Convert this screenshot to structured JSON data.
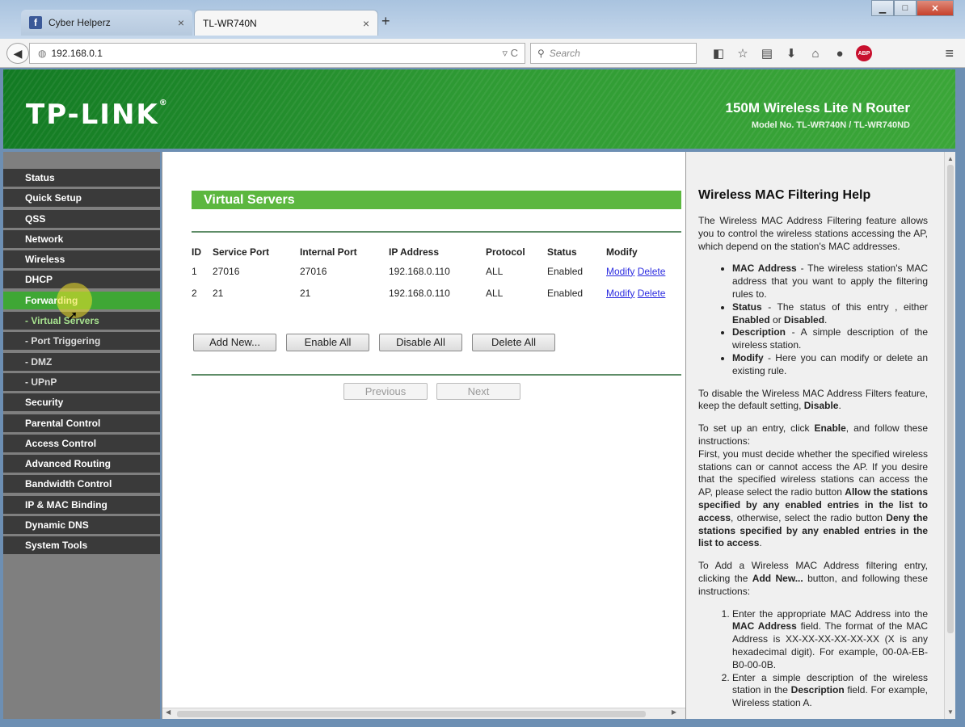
{
  "browser": {
    "tabs": [
      {
        "label": "Cyber Helperz",
        "icon": "facebook-icon"
      },
      {
        "label": "TL-WR740N"
      }
    ],
    "url": "192.168.0.1",
    "search_placeholder": "Search"
  },
  "router": {
    "brand": "TP-LINK",
    "product_name": "150M Wireless Lite N Router",
    "model_no": "Model No. TL-WR740N / TL-WR740ND"
  },
  "menu": [
    {
      "label": "Status"
    },
    {
      "label": "Quick Setup"
    },
    {
      "label": "QSS"
    },
    {
      "label": "Network"
    },
    {
      "label": "Wireless"
    },
    {
      "label": "DHCP"
    },
    {
      "label": "Forwarding",
      "state": "active"
    },
    {
      "label": "- Virtual Servers",
      "state": "subactive"
    },
    {
      "label": "- Port Triggering"
    },
    {
      "label": "- DMZ"
    },
    {
      "label": "- UPnP"
    },
    {
      "label": "Security"
    },
    {
      "label": "Parental Control"
    },
    {
      "label": "Access Control"
    },
    {
      "label": "Advanced Routing"
    },
    {
      "label": "Bandwidth Control"
    },
    {
      "label": "IP & MAC Binding"
    },
    {
      "label": "Dynamic DNS"
    },
    {
      "label": "System Tools"
    }
  ],
  "main": {
    "title": "Virtual Servers",
    "columns": [
      "ID",
      "Service Port",
      "Internal Port",
      "IP Address",
      "Protocol",
      "Status",
      "Modify"
    ],
    "rows": [
      {
        "id": "1",
        "service_port": "27016",
        "internal_port": "27016",
        "ip": "192.168.0.110",
        "protocol": "ALL",
        "status": "Enabled",
        "modify": "Modify",
        "delete": "Delete"
      },
      {
        "id": "2",
        "service_port": "21",
        "internal_port": "21",
        "ip": "192.168.0.110",
        "protocol": "ALL",
        "status": "Enabled",
        "modify": "Modify",
        "delete": "Delete"
      }
    ],
    "buttons": {
      "add_new": "Add New...",
      "enable_all": "Enable All",
      "disable_all": "Disable All",
      "delete_all": "Delete All",
      "previous": "Previous",
      "next": "Next"
    }
  },
  "help": {
    "title": "Wireless MAC Filtering Help",
    "intro": "The Wireless MAC Address Filtering feature allows you to control the wireless stations accessing the AP, which depend on the station's MAC addresses.",
    "bullets": [
      {
        "term": "MAC Address",
        "text": " - The wireless station's MAC address that you want to apply the filtering rules to."
      },
      {
        "term": "Status",
        "text": " - The status of this entry , either ",
        "em1": "Enabled",
        "mid": " or ",
        "em2": "Disabled",
        "end": "."
      },
      {
        "term": "Description",
        "text": " - A simple description of the wireless station."
      },
      {
        "term": "Modify",
        "text": " - Here you can modify or delete an existing rule."
      }
    ],
    "p_disable_a": "To disable the Wireless MAC Address Filters feature, keep the default setting, ",
    "p_disable_b": "Disable",
    "p_setup_a": "To set up an entry, click ",
    "p_setup_b": "Enable",
    "p_setup_c": ", and follow these instructions:",
    "p_first_a": "First, you must decide whether the specified wireless stations can or cannot access the AP. If you desire that the specified wireless stations can access the AP, please select the radio button ",
    "p_first_b": "Allow the stations specified by any enabled entries in the list to access",
    "p_first_c": ", otherwise, select the radio button ",
    "p_first_d": "Deny the stations specified by any enabled entries in the list to access",
    "p_add_a": "To Add a Wireless MAC Address filtering entry, clicking the ",
    "p_add_b": "Add New...",
    "p_add_c": " button, and following these instructions:",
    "steps": [
      {
        "a": "Enter the appropriate MAC Address into the ",
        "b": "MAC Address",
        "c": " field. The format of the MAC Address is XX-XX-XX-XX-XX-XX (X is any hexadecimal digit). For example, 00-0A-EB-B0-00-0B."
      },
      {
        "a": "Enter a simple description of the wireless station in the ",
        "b": "Description",
        "c": " field. For example, Wireless station A."
      }
    ]
  },
  "colors": {
    "brand_green": "#3ba638",
    "menu_active": "#3fa735",
    "link": "#2d2de0"
  }
}
